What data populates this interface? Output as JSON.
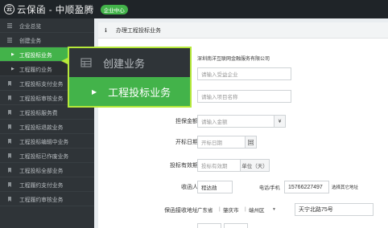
{
  "header": {
    "logo_glyph": "云",
    "brand": "云保函 - 中顺盈腾",
    "badge": "企业中心"
  },
  "sidebar": {
    "items": [
      {
        "label": "企业总览",
        "type": "item"
      },
      {
        "label": "创建业务",
        "type": "item"
      },
      {
        "label": "工程投标业务",
        "type": "sub",
        "active": true
      },
      {
        "label": "工程履约业务",
        "type": "sub"
      },
      {
        "label": "工程投标支付业务",
        "type": "item"
      },
      {
        "label": "工程投标审核业务",
        "type": "item"
      },
      {
        "label": "工程投标服务费",
        "type": "item"
      },
      {
        "label": "工程投标退款业务",
        "type": "item"
      },
      {
        "label": "工程投标编辑中业务",
        "type": "item"
      },
      {
        "label": "工程投标已作废业务",
        "type": "item"
      },
      {
        "label": "工程投标全部业务",
        "type": "item"
      },
      {
        "label": "工程履约支付业务",
        "type": "item"
      },
      {
        "label": "工程履约审核业务",
        "type": "item"
      }
    ]
  },
  "callout": {
    "top_label": "创建业务",
    "bottom_label": "工程投标业务"
  },
  "panel": {
    "title": "办理工程投标业务"
  },
  "form": {
    "company_name": "深圳南洋互联网金融服务有限公司",
    "beneficiary_placeholder": "请输入受益企业",
    "project_placeholder": "请输入项目名称",
    "amount": {
      "label": "担保金额",
      "placeholder": "请输入金额",
      "unit": "¥"
    },
    "bid_date": {
      "label": "开标日期",
      "placeholder": "开标日期"
    },
    "validity": {
      "label": "投标有效期",
      "placeholder": "投标有效期",
      "unit": "单位（天）"
    },
    "recipient": {
      "label": "收函人",
      "name": "程达勋",
      "phone_label": "电话/手机",
      "phone": "15766227497",
      "note": "选择其它地址"
    },
    "address": {
      "label": "保函接收地址",
      "province": "广东省",
      "city": "肇庆市",
      "district": "端州区",
      "detail": "天宁北路75号"
    }
  }
}
